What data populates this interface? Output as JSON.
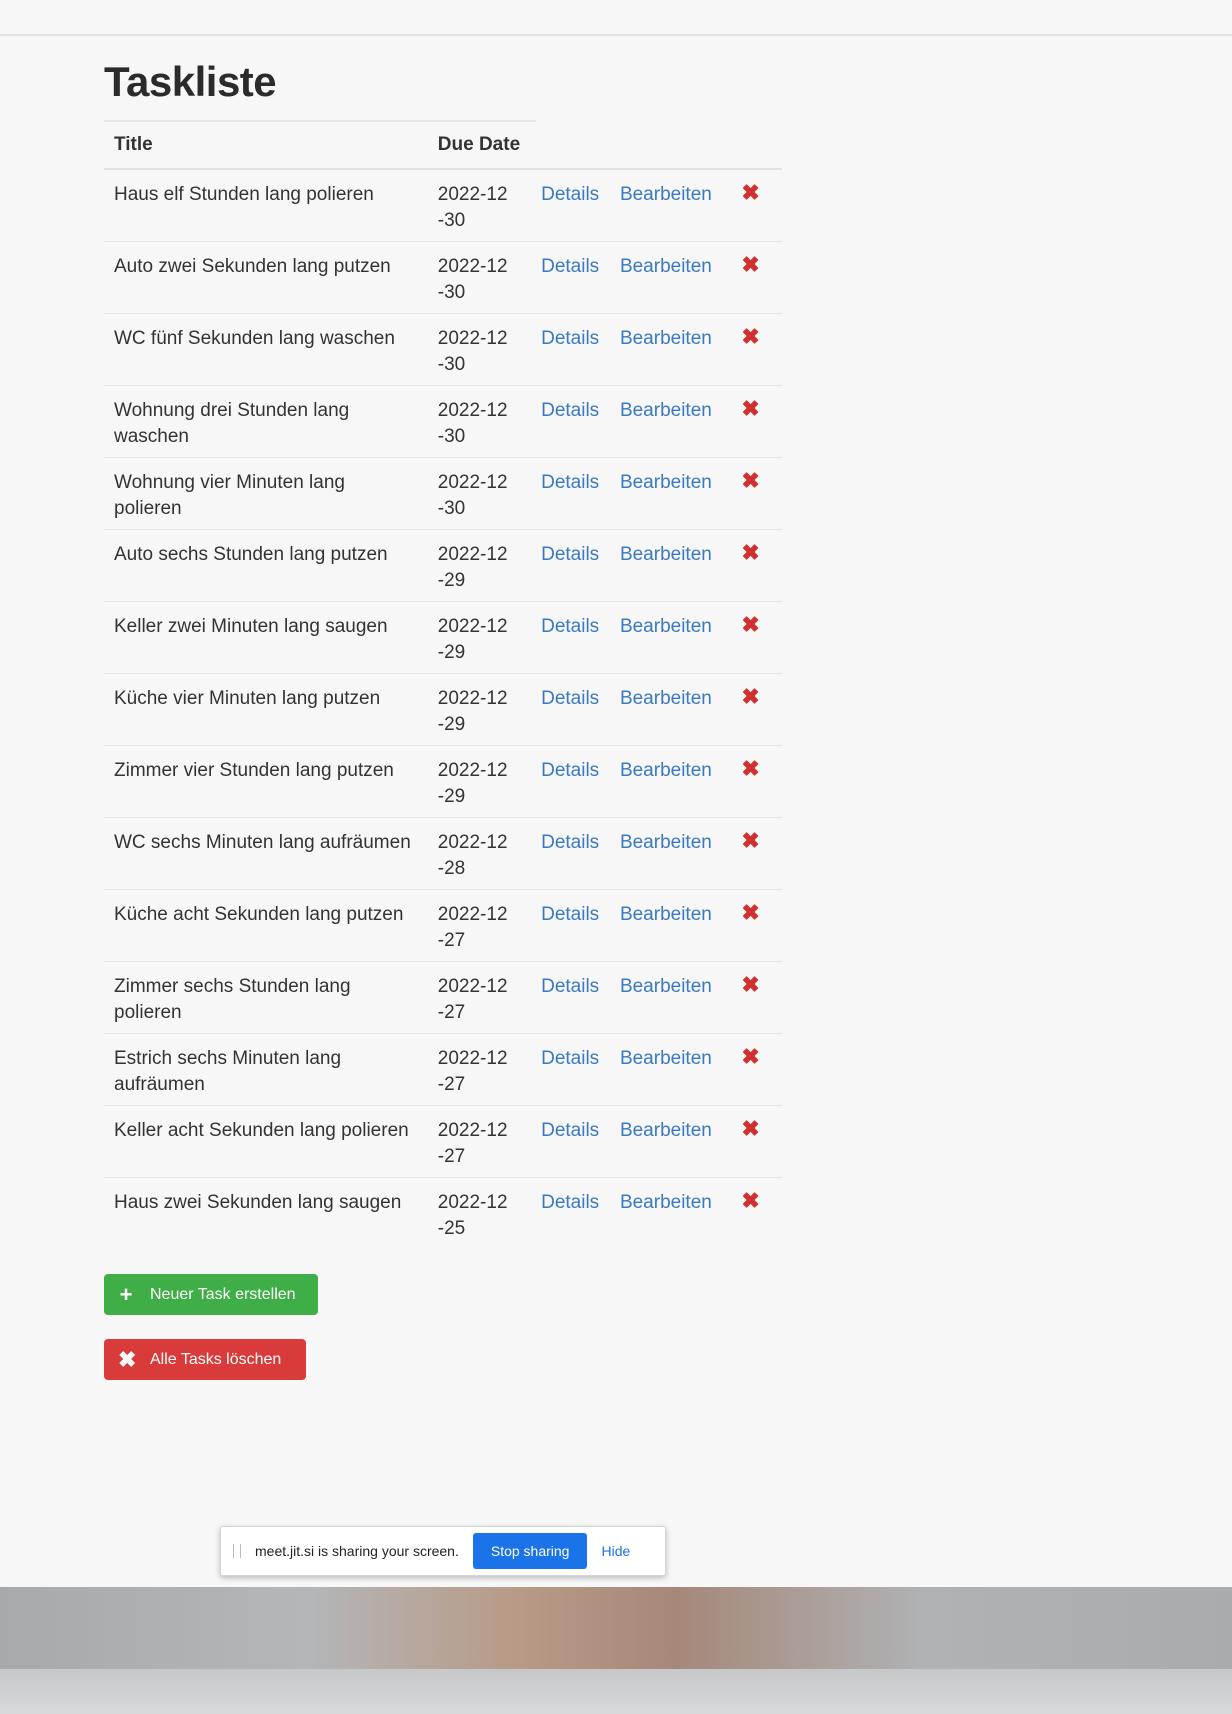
{
  "page": {
    "title": "Taskliste"
  },
  "table": {
    "headers": {
      "title": "Title",
      "due_date": "Due Date"
    },
    "rows": [
      {
        "title": "Haus elf Stunden lang polieren",
        "due": "2022-12-30",
        "details": "Details",
        "edit": "Bearbeiten"
      },
      {
        "title": "Auto zwei Sekunden lang putzen",
        "due": "2022-12-30",
        "details": "Details",
        "edit": "Bearbeiten"
      },
      {
        "title": "WC fünf Sekunden lang waschen",
        "due": "2022-12-30",
        "details": "Details",
        "edit": "Bearbeiten"
      },
      {
        "title": "Wohnung drei Stunden lang waschen",
        "due": "2022-12-30",
        "details": "Details",
        "edit": "Bearbeiten"
      },
      {
        "title": "Wohnung vier Minuten lang polieren",
        "due": "2022-12-30",
        "details": "Details",
        "edit": "Bearbeiten"
      },
      {
        "title": "Auto sechs Stunden lang putzen",
        "due": "2022-12-29",
        "details": "Details",
        "edit": "Bearbeiten"
      },
      {
        "title": "Keller zwei Minuten lang saugen",
        "due": "2022-12-29",
        "details": "Details",
        "edit": "Bearbeiten"
      },
      {
        "title": "Küche vier Minuten lang putzen",
        "due": "2022-12-29",
        "details": "Details",
        "edit": "Bearbeiten"
      },
      {
        "title": "Zimmer vier Stunden lang putzen",
        "due": "2022-12-29",
        "details": "Details",
        "edit": "Bearbeiten"
      },
      {
        "title": "WC sechs Minuten lang aufräumen",
        "due": "2022-12-28",
        "details": "Details",
        "edit": "Bearbeiten"
      },
      {
        "title": "Küche acht Sekunden lang putzen",
        "due": "2022-12-27",
        "details": "Details",
        "edit": "Bearbeiten"
      },
      {
        "title": "Zimmer sechs Stunden lang polieren",
        "due": "2022-12-27",
        "details": "Details",
        "edit": "Bearbeiten"
      },
      {
        "title": "Estrich sechs Minuten lang aufräumen",
        "due": "2022-12-27",
        "details": "Details",
        "edit": "Bearbeiten"
      },
      {
        "title": "Keller acht Sekunden lang polieren",
        "due": "2022-12-27",
        "details": "Details",
        "edit": "Bearbeiten"
      },
      {
        "title": "Haus zwei Sekunden lang saugen",
        "due": "2022-12-25",
        "details": "Details",
        "edit": "Bearbeiten"
      }
    ],
    "delete_glyph": "✖"
  },
  "buttons": {
    "new_task": {
      "icon": "plus-icon",
      "glyph": "+",
      "label": "Neuer Task erstellen",
      "color": "#3fae46"
    },
    "delete_all": {
      "icon": "close-icon",
      "glyph": "✖",
      "label": "Alle Tasks löschen",
      "color": "#d93a3a"
    }
  },
  "share_bar": {
    "message": "meet.jit.si is sharing your screen.",
    "stop_label": "Stop sharing",
    "hide_label": "Hide"
  },
  "colors": {
    "link": "#3a79c2",
    "delete": "#d32f2f",
    "stop_button": "#1a73e8"
  }
}
